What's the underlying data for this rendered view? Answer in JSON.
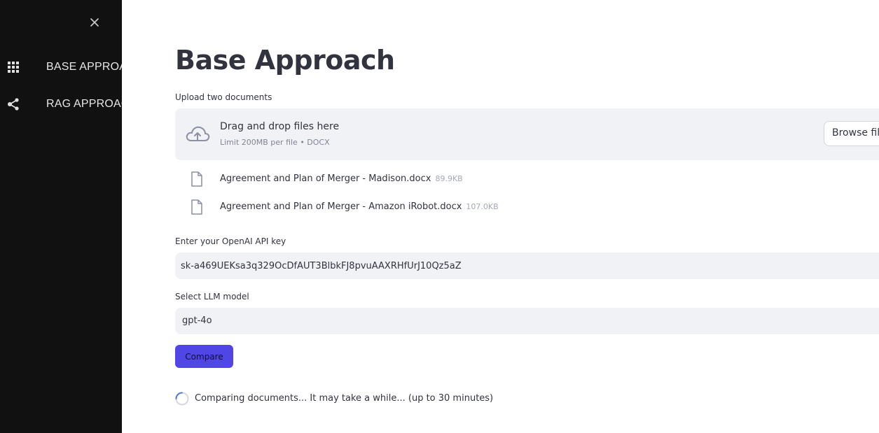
{
  "sidebar": {
    "close_icon": "close-icon",
    "items": [
      {
        "label": "BASE APPROACH",
        "icon": "grid-icon"
      },
      {
        "label": "RAG APPROACH",
        "icon": "share-icon"
      }
    ]
  },
  "main": {
    "title": "Base Approach",
    "upload": {
      "label": "Upload two documents",
      "drop_title": "Drag and drop files here",
      "drop_subtitle": "Limit 200MB per file • DOCX",
      "browse_label": "Browse files",
      "files": [
        {
          "name": "Agreement and Plan of Merger - Madison.docx",
          "size": "89.9KB"
        },
        {
          "name": "Agreement and Plan of Merger - Amazon iRobot.docx",
          "size": "107.0KB"
        }
      ]
    },
    "api_key": {
      "label": "Enter your OpenAI API key",
      "value": "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"
    },
    "model": {
      "label": "Select LLM model",
      "selected": "gpt-4o"
    },
    "compare_label": "Compare",
    "status": "Comparing documents... It may take a while... (up to 30 minutes)"
  },
  "colors": {
    "sidebar_bg": "#111111",
    "accent": "#4f46e5",
    "input_bg": "#f0f2f6",
    "text": "#31333f"
  }
}
